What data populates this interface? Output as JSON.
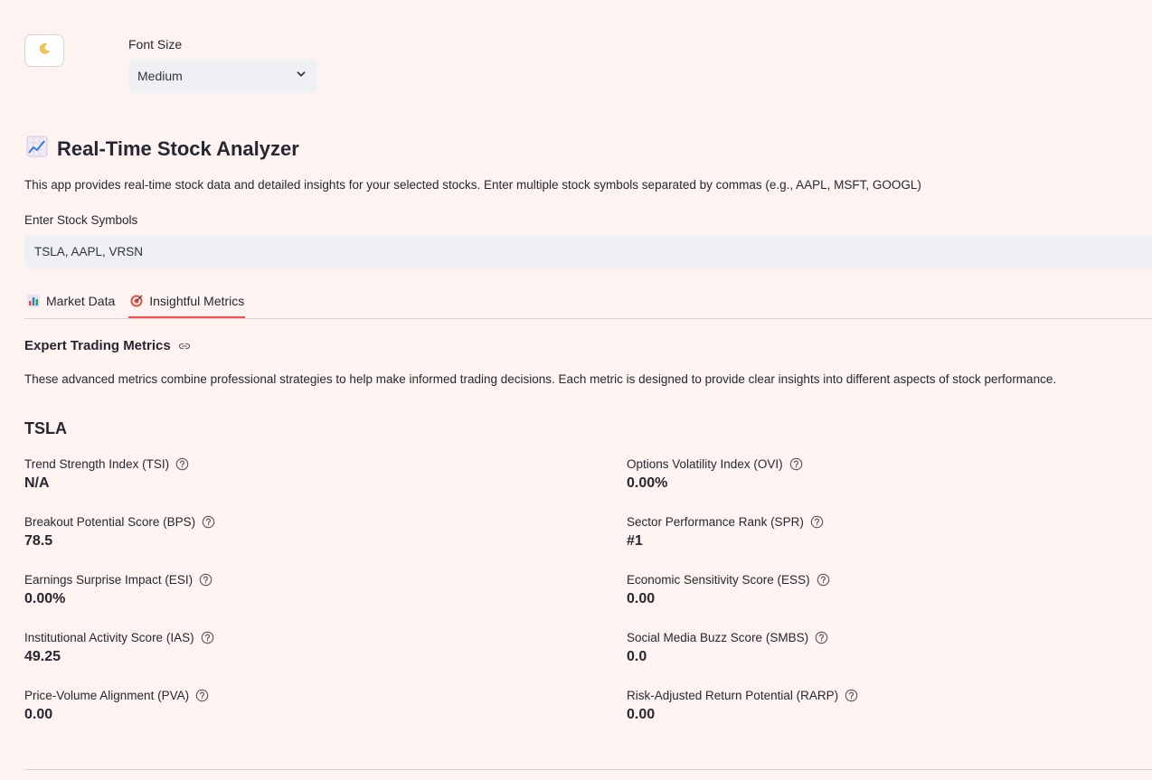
{
  "settings": {
    "theme_icon": "moon-icon",
    "font_size_label": "Font Size",
    "font_size_value": "Medium"
  },
  "app": {
    "title": "Real-Time Stock Analyzer",
    "description": "This app provides real-time stock data and detailed insights for your selected stocks. Enter multiple stock symbols separated by commas (e.g., AAPL, MSFT, GOOGL)",
    "symbols_label": "Enter Stock Symbols",
    "symbols_value": "TSLA, AAPL, VRSN"
  },
  "tabs": [
    {
      "label": "Market Data",
      "icon": "bar-chart-icon",
      "active": false
    },
    {
      "label": "Insightful Metrics",
      "icon": "target-icon",
      "active": true
    }
  ],
  "section": {
    "title": "Expert Trading Metrics",
    "description": "These advanced metrics combine professional strategies to help make informed trading decisions. Each metric is designed to provide clear insights into different aspects of stock performance."
  },
  "stock": {
    "ticker": "TSLA",
    "left_metrics": [
      {
        "label": "Trend Strength Index (TSI)",
        "value": "N/A"
      },
      {
        "label": "Breakout Potential Score (BPS)",
        "value": "78.5"
      },
      {
        "label": "Earnings Surprise Impact (ESI)",
        "value": "0.00%"
      },
      {
        "label": "Institutional Activity Score (IAS)",
        "value": "49.25"
      },
      {
        "label": "Price-Volume Alignment (PVA)",
        "value": "0.00"
      }
    ],
    "right_metrics": [
      {
        "label": "Options Volatility Index (OVI)",
        "value": "0.00%"
      },
      {
        "label": "Sector Performance Rank (SPR)",
        "value": "#1"
      },
      {
        "label": "Economic Sensitivity Score (ESS)",
        "value": "0.00"
      },
      {
        "label": "Social Media Buzz Score (SMBS)",
        "value": "0.0"
      },
      {
        "label": "Risk-Adjusted Return Potential (RARP)",
        "value": "0.00"
      }
    ]
  },
  "colors": {
    "background": "#fdf3f1",
    "accent": "#ff4b4b",
    "input_bg": "#eef0f4"
  }
}
